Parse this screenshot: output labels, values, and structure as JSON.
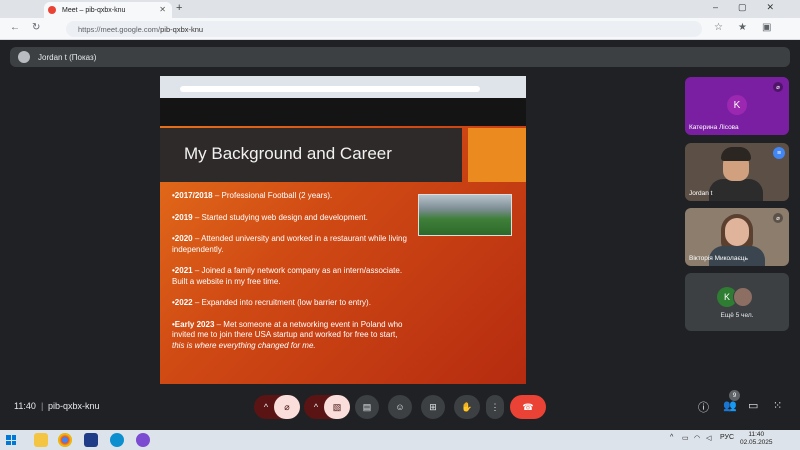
{
  "browser": {
    "tab_title": "Meet – pib-qxbx-knu",
    "new_tab_icon": "+",
    "url_host": "https://meet.google.com/",
    "url_path": "pib-qxbx-knu"
  },
  "meet": {
    "presenter_label": "Jordan t (Показ)",
    "slide": {
      "title": "My Background and Career",
      "bullets": [
        {
          "year": "•2017/2018",
          "text": " – Professional Football (2 years)."
        },
        {
          "year": "•2019",
          "text": " – Started studying web design and development."
        },
        {
          "year": "•2020",
          "text": " – Attended university and worked in a restaurant while living independently."
        },
        {
          "year": "•2021",
          "text": " – Joined a family network company as an intern/associate. Built a website in my free time."
        },
        {
          "year": "•2022",
          "text": " – Expanded into recruitment (low barrier to entry)."
        },
        {
          "year": "•Early 2023",
          "text": " – Met someone at a networking event in Poland who invited me to join there USA startup and worked for free to start, ",
          "italic": "this is where everything changed for me."
        }
      ]
    },
    "participants": [
      {
        "name": "Катерина Лісова",
        "initial": "K"
      },
      {
        "name": "Jordan t"
      },
      {
        "name": "Вікторія Миколаєць"
      }
    ],
    "more": {
      "initial": "K",
      "label": "Ещё 5 чел."
    },
    "bottom": {
      "time": "11:40",
      "separator": "|",
      "meeting_code": "pib-qxbx-knu",
      "people_badge": "9"
    }
  },
  "taskbar": {
    "lang": "РУС",
    "time": "11:40",
    "date": "02.05.2025"
  },
  "colors": {
    "accent_red": "#ea4335",
    "meet_bg": "#202124",
    "slide_orange": "#e66a17"
  }
}
